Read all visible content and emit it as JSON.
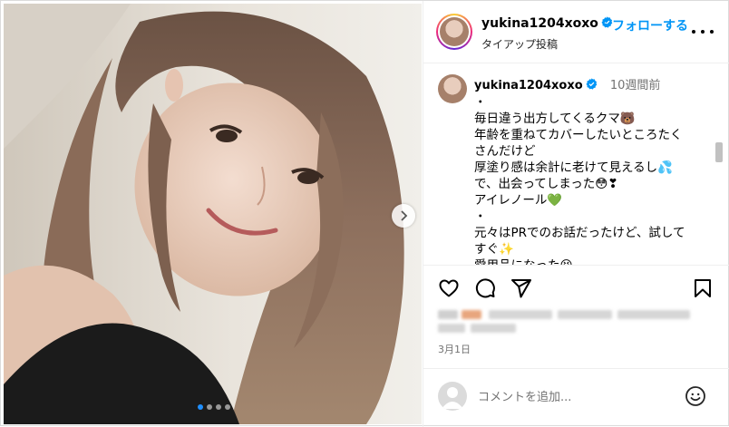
{
  "header": {
    "username": "yukina1204xoxo",
    "follow_label": "・フォローする",
    "subtitle": "タイアップ投稿"
  },
  "caption": {
    "username": "yukina1204xoxo",
    "time": "10週間前",
    "lines": [
      "・",
      "毎日違う出方してくるクマ🐻",
      "年齢を重ねてカバーしたいところたく",
      "さんだけど",
      "厚塗り感は余計に老けて見えるし💦",
      "で、出会ってしまった😳❣",
      "アイレノール💚",
      "・",
      "元々はPRでのお話だったけど、試して",
      "すぐ✨",
      "愛用品になった😆"
    ]
  },
  "post": {
    "date": "3月1日",
    "carousel_count": 4,
    "carousel_active": 0
  },
  "comment": {
    "placeholder": "コメントを追加..."
  },
  "icons": {
    "verified": "verified-badge-icon",
    "more": "more-options-icon",
    "like": "heart-icon",
    "comment": "comment-icon",
    "share": "share-icon",
    "save": "bookmark-icon",
    "next": "chevron-right-icon",
    "emoji": "emoji-icon"
  },
  "colors": {
    "link_blue": "#0095f6",
    "verified_blue": "#0095f6",
    "carousel_active_dot": "#1f8fff"
  }
}
